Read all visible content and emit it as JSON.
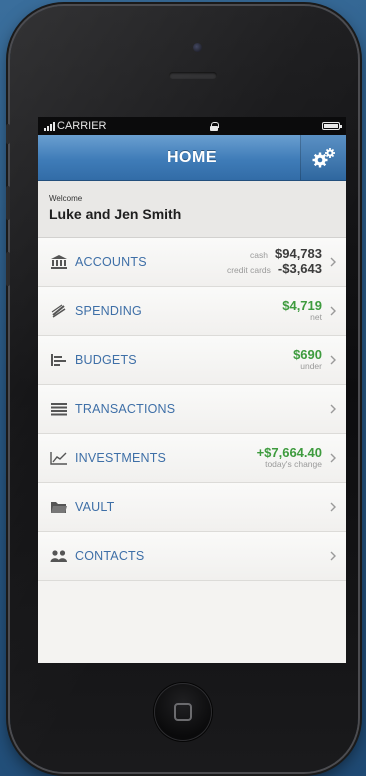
{
  "status_bar": {
    "carrier": "CARRIER"
  },
  "nav": {
    "title": "HOME",
    "settings_icon": "gear-icon"
  },
  "welcome": {
    "label": "Welcome",
    "name": "Luke and Jen Smith"
  },
  "menu": {
    "accounts": {
      "label": "ACCOUNTS",
      "icon": "bank-icon",
      "cash_label": "cash",
      "cash_value": "$94,783",
      "credit_label": "credit cards",
      "credit_value": "-$3,643"
    },
    "spending": {
      "label": "SPENDING",
      "icon": "spending-icon",
      "value": "$4,719",
      "sub": "net"
    },
    "budgets": {
      "label": "BUDGETS",
      "icon": "bar-chart-icon",
      "value": "$690",
      "sub": "under"
    },
    "transactions": {
      "label": "TRANSACTIONS",
      "icon": "list-icon"
    },
    "investments": {
      "label": "INVESTMENTS",
      "icon": "line-chart-icon",
      "value": "+$7,664.40",
      "sub": "today's change"
    },
    "vault": {
      "label": "VAULT",
      "icon": "folder-icon"
    },
    "contacts": {
      "label": "CONTACTS",
      "icon": "people-icon"
    }
  },
  "colors": {
    "nav_blue": "#3f7cb8",
    "link_blue": "#3e6fa7",
    "positive_green": "#3e9b3e"
  }
}
